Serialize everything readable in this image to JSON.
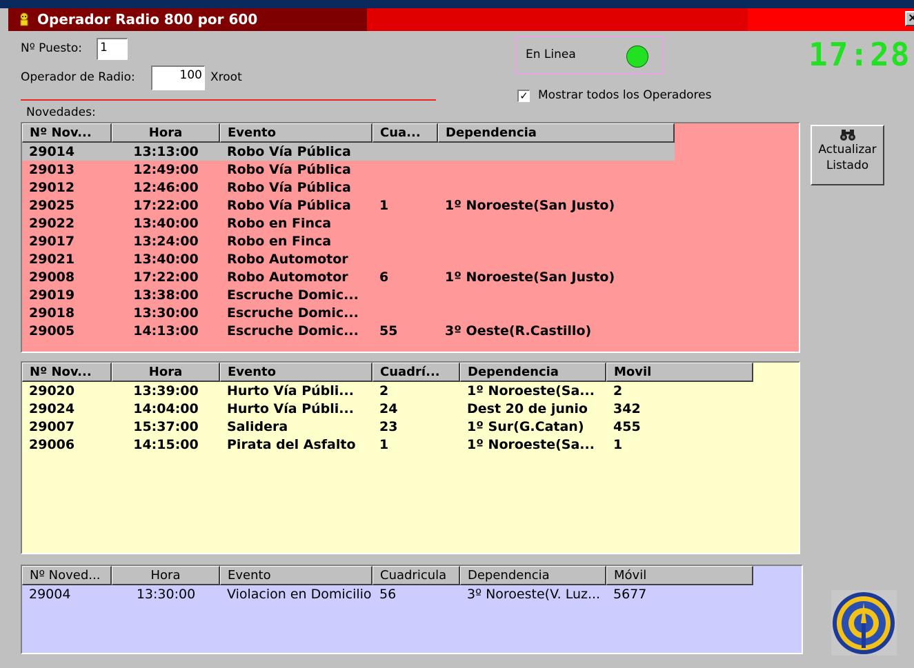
{
  "window": {
    "title": "Operador Radio 800 por 600",
    "close_glyph": "×",
    "icon": "app-icon"
  },
  "form": {
    "puesto_label": "Nº Puesto:",
    "puesto_value": "1",
    "operador_label": "Operador de Radio:",
    "operador_value": "100",
    "operador_name": "Xroot"
  },
  "status": {
    "online_label": "En Linea",
    "online_color": "#22e022",
    "show_all_label": "Mostrar todos los Operadores",
    "show_all_checked": "✓"
  },
  "clock": "17:28",
  "novedades_label": "Novedades:",
  "refresh_button": {
    "icon": "binoculars-icon",
    "line1": "Actualizar",
    "line2": "Listado"
  },
  "colors": {
    "grid1_bg": "#ff9999",
    "grid2_bg": "#ffffcc",
    "grid3_bg": "#ccccff",
    "selected_row": "#c0c0c0"
  },
  "grid1": {
    "headers": [
      "Nº Nov...",
      "Hora",
      "Evento",
      "Cua...",
      "Dependencia"
    ],
    "rows": [
      [
        "29014",
        "13:13:00",
        "Robo Vía Pública",
        "",
        ""
      ],
      [
        "29013",
        "12:49:00",
        "Robo Vía Pública",
        "",
        ""
      ],
      [
        "29012",
        "12:46:00",
        "Robo Vía Pública",
        "",
        ""
      ],
      [
        "29025",
        "17:22:00",
        "Robo Vía Pública",
        "1",
        "1º Noroeste(San Justo)"
      ],
      [
        "29022",
        "13:40:00",
        "Robo en Finca",
        "",
        ""
      ],
      [
        "29017",
        "13:24:00",
        "Robo en Finca",
        "",
        ""
      ],
      [
        "29021",
        "13:40:00",
        "Robo Automotor",
        "",
        ""
      ],
      [
        "29008",
        "17:22:00",
        "Robo Automotor",
        "6",
        "1º Noroeste(San Justo)"
      ],
      [
        "29019",
        "13:38:00",
        "Escruche Domic...",
        "",
        ""
      ],
      [
        "29018",
        "13:30:00",
        "Escruche Domic...",
        "",
        ""
      ],
      [
        "29005",
        "14:13:00",
        "Escruche Domic...",
        "55",
        "3º Oeste(R.Castillo)"
      ]
    ]
  },
  "grid2": {
    "headers": [
      "Nº Nov...",
      "Hora",
      "Evento",
      "Cuadrí...",
      "Dependencia",
      "Movil"
    ],
    "rows": [
      [
        "29020",
        "13:39:00",
        "Hurto Vía Públi...",
        "2",
        "1º Noroeste(Sa...",
        "2"
      ],
      [
        "29024",
        "14:04:00",
        "Hurto Vía Públi...",
        "24",
        "Dest 20 de junio",
        "342"
      ],
      [
        "29007",
        "15:37:00",
        "Salidera",
        "23",
        "1º Sur(G.Catan)",
        "455"
      ],
      [
        "29006",
        "14:15:00",
        "Pirata del Asfalto",
        "1",
        "1º Noroeste(Sa...",
        "1"
      ]
    ]
  },
  "grid3": {
    "headers": [
      "Nº Noved...",
      "Hora",
      "Evento",
      "Cuadricula",
      "Dependencia",
      "Móvil"
    ],
    "rows": [
      [
        "29004",
        "13:30:00",
        "Violacion en Domicilio",
        "56",
        "3º Noroeste(V. Luz...",
        "5677"
      ]
    ]
  },
  "logo": "emblem-logo"
}
